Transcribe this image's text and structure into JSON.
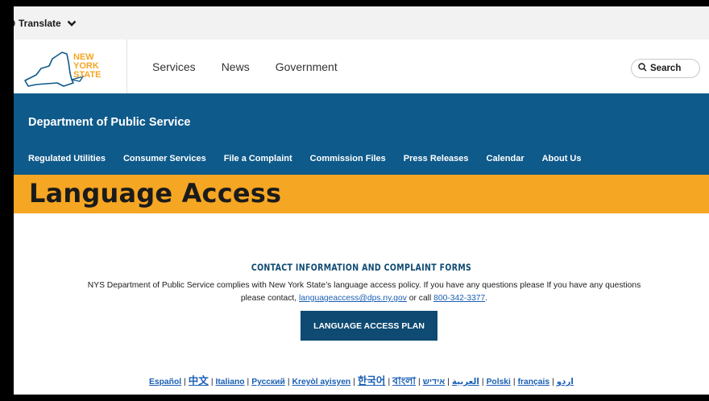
{
  "translate": {
    "label": "Translate"
  },
  "header": {
    "logo_lines": [
      "NEW",
      "YORK",
      "STATE"
    ],
    "nav": [
      "Services",
      "News",
      "Government"
    ],
    "search_label": "Search"
  },
  "agency": {
    "title": "Department of Public Service",
    "nav": [
      "Regulated Utilities",
      "Consumer Services",
      "File a Complaint",
      "Commission Files",
      "Press Releases",
      "Calendar",
      "About Us"
    ]
  },
  "page": {
    "title": "Language Access"
  },
  "content": {
    "heading": "CONTACT INFORMATION AND COMPLAINT FORMS",
    "body_line1": "NYS Department of Public Service complies with New York State’s language access policy. If you have any questions please  If you have any questions",
    "body_line2_prefix": "please contact, ",
    "email": "languageaccess@dps.ny.gov",
    "body_line2_mid": " or call ",
    "phone": "800-342-3377",
    "body_line2_suffix": ".",
    "plan_button": "LANGUAGE ACCESS PLAN",
    "languages": [
      "Español",
      "中文",
      "Italiano",
      "Русский",
      "Kreyòl ayisyen",
      "한국어",
      "বাংলা",
      "العربية",
      "אידיש",
      "Polski",
      "français",
      "اردو"
    ]
  },
  "colors": {
    "agency_blue": "#0e5a8a",
    "title_orange": "#f5a623",
    "link_blue": "#1a5fb4",
    "nav_dark": "#0e4a72"
  }
}
